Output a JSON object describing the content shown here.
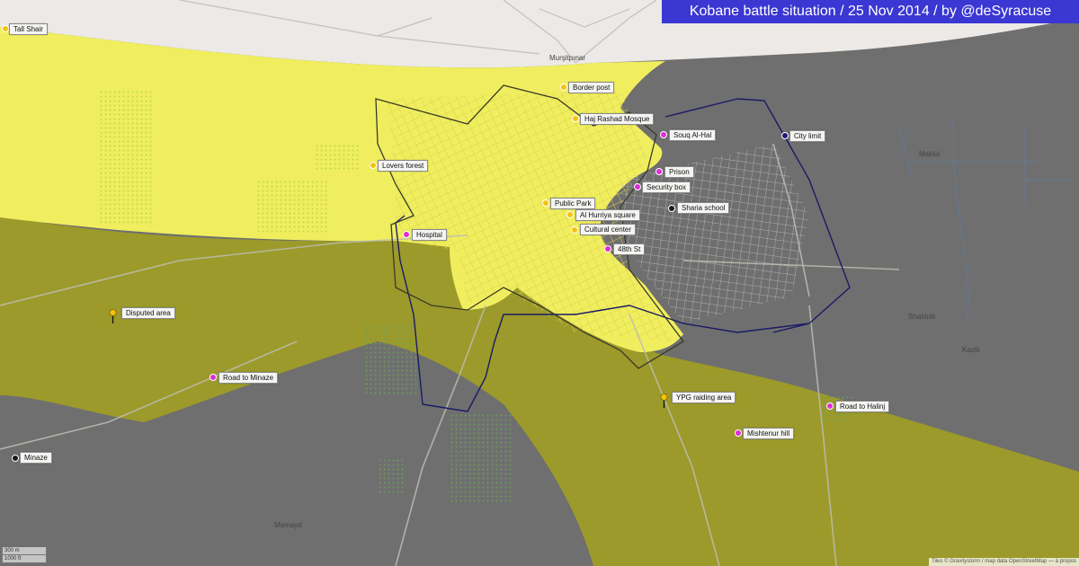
{
  "title": "Kobane battle situation / 25 Nov 2014 / by @deSyracuse",
  "colors": {
    "kurdish_controlled": "#f0ee5e",
    "isis_controlled": "#6f6f6f",
    "disputed": "#9c9a2a",
    "turkey": "#ece9e6",
    "city_limit": "#1b1a66",
    "front_line": "#3a3a2a",
    "marker_kurdish": "#f4c20d",
    "marker_isis": "#e02bd6",
    "marker_neutral": "#1a1a1a",
    "marker_city_limit": "#1c1a7a"
  },
  "towns": {
    "mursitpinar": "Murşitpınar",
    "maklul": "Maklul",
    "shahinik": "Shahinik",
    "mamayd": "Mamayd",
    "kazik": "Kazik"
  },
  "labels": {
    "tall_shair": "Tall Shair",
    "border_post": "Border post",
    "haj_rashad": "Haj Rashad Mosque",
    "souq_al_hal": "Souq Al-Hal",
    "city_limit": "City limit",
    "lovers_forest": "Lovers forest",
    "prison": "Prison",
    "security_box": "Security box",
    "public_park": "Public Park",
    "sharia_school": "Sharia school",
    "al_hurriya": "Al Hurriya square",
    "cultural_center": "Cultural center",
    "hospital": "Hospital",
    "st_48": "48th St",
    "disputed_area": "Disputed area",
    "road_to_minaze": "Road to Minaze",
    "ypg_raiding": "YPG raiding area",
    "road_to_halinj": "Road to Halinj",
    "mishtenur_hill": "Mishtenur hill",
    "minaze": "Minaze"
  },
  "scale": {
    "metric": "300 m",
    "imperial": "1000 ft"
  },
  "attribution": "Tiles © Gravitystorm / map data OpenStreetMap — à propos"
}
